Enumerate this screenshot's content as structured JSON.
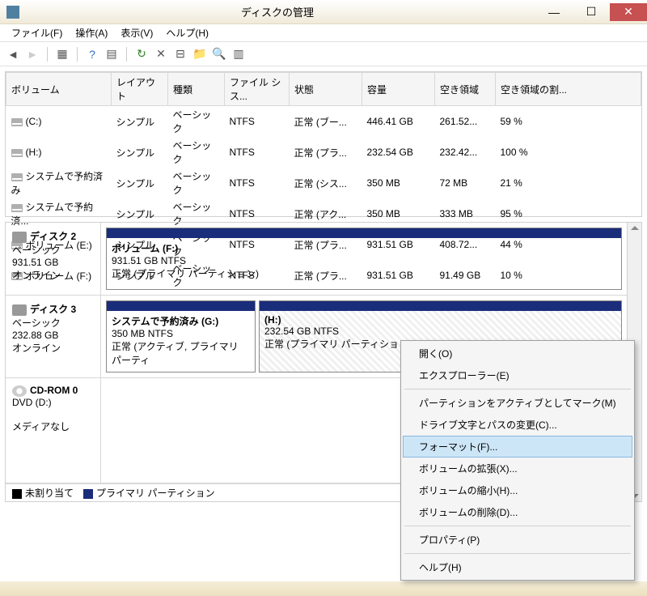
{
  "window": {
    "title": "ディスクの管理"
  },
  "menubar": {
    "file": "ファイル(F)",
    "action": "操作(A)",
    "view": "表示(V)",
    "help": "ヘルプ(H)"
  },
  "columns": {
    "volume": "ボリューム",
    "layout": "レイアウト",
    "type": "種類",
    "filesystem": "ファイル シス...",
    "status": "状態",
    "capacity": "容量",
    "free": "空き領域",
    "freepct": "空き領域の割..."
  },
  "volumes": [
    {
      "name": "(C:)",
      "layout": "シンプル",
      "type": "ベーシック",
      "fs": "NTFS",
      "status": "正常 (ブー...",
      "cap": "446.41 GB",
      "free": "261.52...",
      "pct": "59 %"
    },
    {
      "name": "(H:)",
      "layout": "シンプル",
      "type": "ベーシック",
      "fs": "NTFS",
      "status": "正常 (プラ...",
      "cap": "232.54 GB",
      "free": "232.42...",
      "pct": "100 %"
    },
    {
      "name": "システムで予約済み",
      "layout": "シンプル",
      "type": "ベーシック",
      "fs": "NTFS",
      "status": "正常 (シス...",
      "cap": "350 MB",
      "free": "72 MB",
      "pct": "21 %"
    },
    {
      "name": "システムで予約済...",
      "layout": "シンプル",
      "type": "ベーシック",
      "fs": "NTFS",
      "status": "正常 (アク...",
      "cap": "350 MB",
      "free": "333 MB",
      "pct": "95 %"
    },
    {
      "name": "ボリューム (E:)",
      "layout": "シンプル",
      "type": "ベーシック",
      "fs": "NTFS",
      "status": "正常 (プラ...",
      "cap": "931.51 GB",
      "free": "408.72...",
      "pct": "44 %"
    },
    {
      "name": "ボリューム (F:)",
      "layout": "シンプル",
      "type": "ベーシック",
      "fs": "NTFS",
      "status": "正常 (プラ...",
      "cap": "931.51 GB",
      "free": "91.49 GB",
      "pct": "10 %"
    }
  ],
  "disks": {
    "disk2": {
      "name": "ディスク 2",
      "type": "ベーシック",
      "size": "931.51 GB",
      "status": "オンライン",
      "part0": {
        "label": "ボリューム  (F:)",
        "sub": "931.51 GB NTFS",
        "status": "正常 (プライマリ パーティション)"
      }
    },
    "disk3": {
      "name": "ディスク 3",
      "type": "ベーシック",
      "size": "232.88 GB",
      "status": "オンライン",
      "part0": {
        "label": "システムで予約済み  (G:)",
        "sub": "350 MB NTFS",
        "status": "正常 (アクティブ, プライマリ パーティ"
      },
      "part1": {
        "label": " (H:)",
        "sub": "232.54 GB NTFS",
        "status": "正常 (プライマリ パーティション)"
      }
    },
    "cdrom": {
      "name": "CD-ROM 0",
      "type": "DVD (D:)",
      "status": "メディアなし"
    }
  },
  "legend": {
    "unalloc": "未割り当て",
    "primary": "プライマリ パーティション"
  },
  "ctx": {
    "open": "開く(O)",
    "explorer": "エクスプローラー(E)",
    "active": "パーティションをアクティブとしてマーク(M)",
    "drive": "ドライブ文字とパスの変更(C)...",
    "format": "フォーマット(F)...",
    "extend": "ボリュームの拡張(X)...",
    "shrink": "ボリュームの縮小(H)...",
    "delete": "ボリュームの削除(D)...",
    "props": "プロパティ(P)",
    "help": "ヘルプ(H)"
  }
}
